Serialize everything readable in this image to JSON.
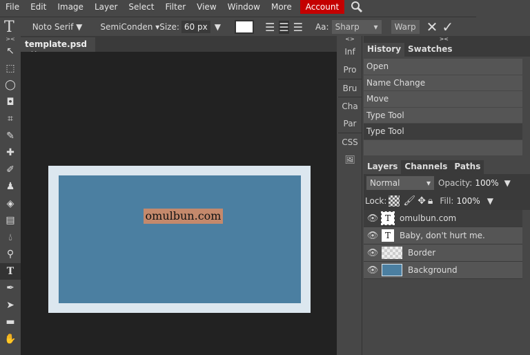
{
  "menu": [
    "File",
    "Edit",
    "Image",
    "Layer",
    "Select",
    "Filter",
    "View",
    "Window",
    "More",
    "Account"
  ],
  "options": {
    "tool_icon": "T",
    "font": "Noto Serif ▼",
    "style": "SemiConden ▾",
    "size_label": "Size:",
    "size": "60 px",
    "size_arrow": "▼",
    "aa_label": "Aa:",
    "aa": "Sharp",
    "aa_arrow": "▾",
    "warp": "Warp",
    "cancel": "✕",
    "commit": "✓"
  },
  "document": {
    "tab": "template.psd",
    "close": "✕",
    "text": "omulbun.com",
    "colors": {
      "border": "#dce7ef",
      "fill": "#4b7fa1",
      "highlight": "#c4896c"
    }
  },
  "mini_panels": [
    "Inf",
    "Pro",
    "Bru",
    "Cha",
    "Par",
    "CSS"
  ],
  "history": {
    "tabs": [
      "History",
      "Swatches"
    ],
    "items": [
      "Open",
      "Name Change",
      "Move",
      "Type Tool",
      "Type Tool"
    ]
  },
  "layers": {
    "tabs": [
      "Layers",
      "Channels",
      "Paths"
    ],
    "blend": "Normal",
    "opacity_label": "Opacity:",
    "opacity": "100%",
    "lock_label": "Lock:",
    "fill_label": "Fill:",
    "fill": "100%",
    "items": [
      {
        "name": "omulbun.com",
        "type": "T"
      },
      {
        "name": "Baby, don't hurt me.",
        "type": "T"
      },
      {
        "name": "Border",
        "type": "raster"
      },
      {
        "name": "Background",
        "type": "raster"
      }
    ]
  }
}
